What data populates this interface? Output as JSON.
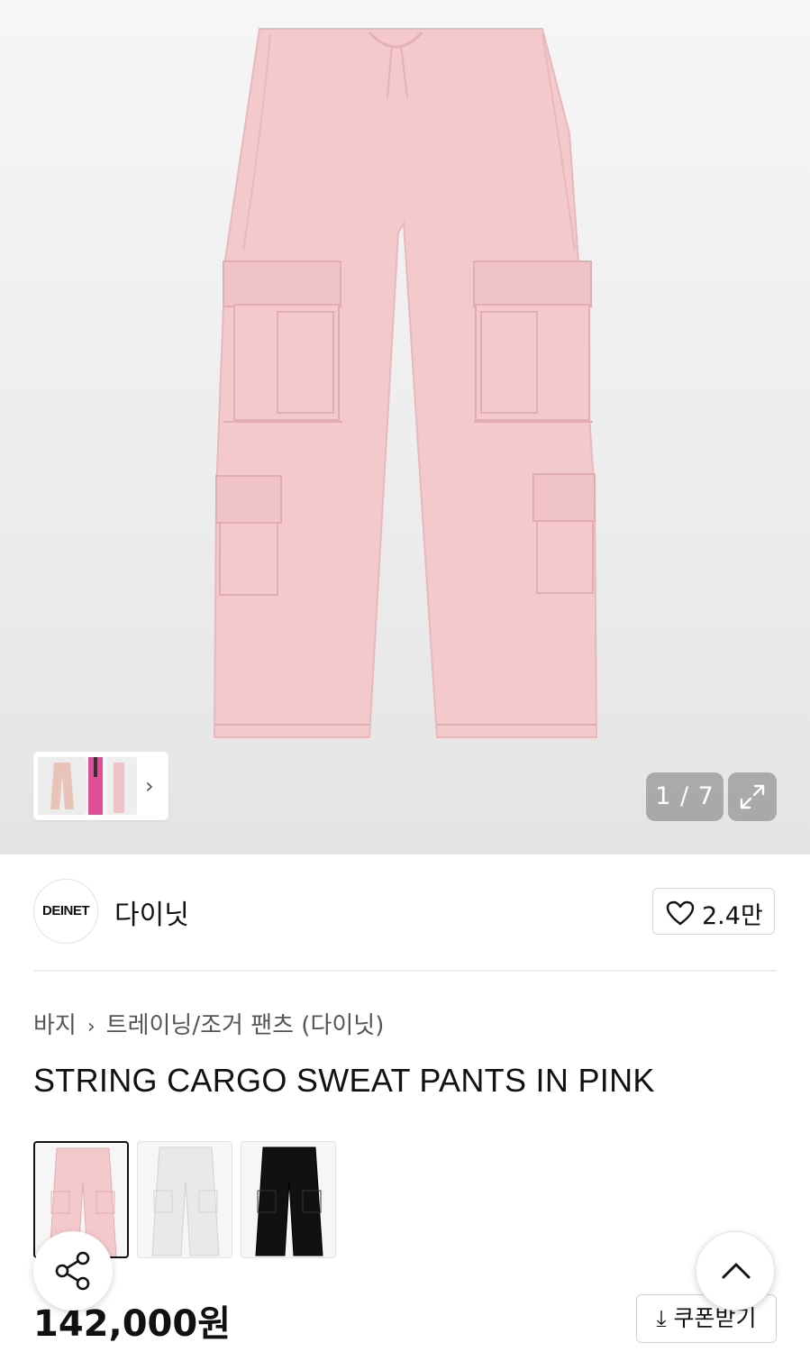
{
  "gallery": {
    "counter_text": "1 / 7",
    "thumbnail_next_glyph": "›",
    "expand_icon": "expand-icon"
  },
  "brand": {
    "logo_text": "DEINET",
    "name": "다이닛",
    "like_count": "2.4만"
  },
  "breadcrumb": {
    "items": [
      "바지",
      "트레이닝/조거 팬츠 (다이닛)"
    ],
    "separator": "›"
  },
  "product": {
    "title": "STRING CARGO SWEAT PANTS IN PINK",
    "price": "142,000원",
    "color_options": [
      {
        "color": "#f3c9cc",
        "selected": true
      },
      {
        "color": "#e9e9e9",
        "selected": false
      },
      {
        "color": "#111111",
        "selected": false
      }
    ]
  },
  "actions": {
    "coupon_label": "쿠폰받기",
    "share_icon": "share-icon",
    "scroll_top_icon": "chevron-up-icon"
  },
  "colors": {
    "pants_pink": "#f3c9cc",
    "hero_bg": "#eeeeee",
    "overlay_gray": "#8a8a8a"
  }
}
